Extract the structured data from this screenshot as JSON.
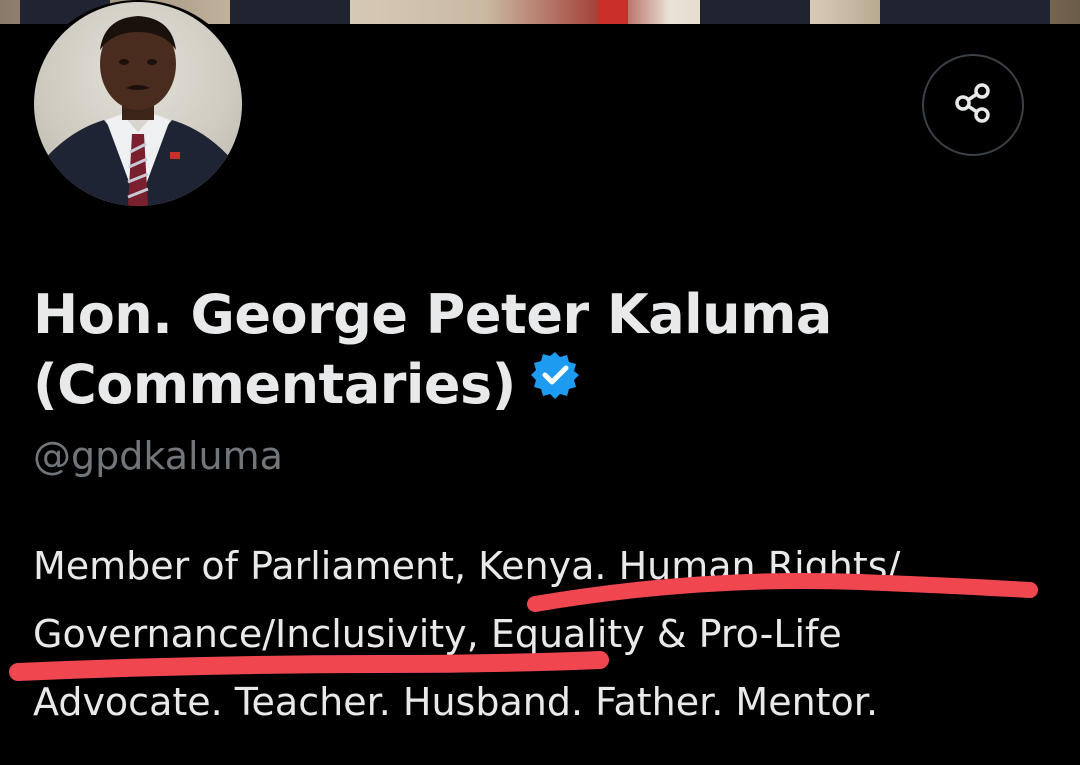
{
  "profile": {
    "name_line1": "Hon. George Peter Kaluma",
    "name_line2": "(Commentaries)",
    "handle": "@gpdkaluma",
    "bio_line1": "Member of Parliament, Kenya. Human Rights/",
    "bio_line2": "Governance/Inclusivity, Equality & Pro-Life",
    "bio_line3": "Advocate. Teacher. Husband. Father. Mentor.",
    "verified": true
  },
  "icons": {
    "share": "share-icon",
    "verified": "verified-badge-icon"
  },
  "colors": {
    "background": "#000000",
    "primary_text": "#e7e9ea",
    "secondary_text": "#71767b",
    "verified_blue": "#1d9bf0",
    "highlight_marker": "#f0464f"
  }
}
